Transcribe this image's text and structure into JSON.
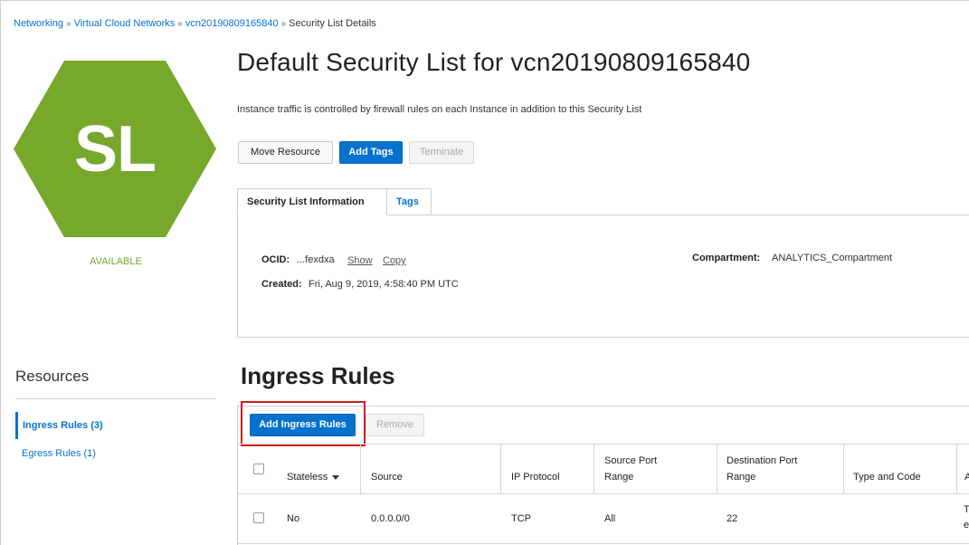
{
  "breadcrumb": {
    "items": [
      "Networking",
      "Virtual Cloud Networks",
      "vcn20190809165840"
    ],
    "current": "Security List Details",
    "separator": "»"
  },
  "resource_icon": {
    "text": "SL",
    "color": "#76a82c"
  },
  "status": "AVAILABLE",
  "page_title": "Default Security List for vcn20190809165840",
  "description": "Instance traffic is controlled by firewall rules on each Instance in addition to this Security List",
  "actions": {
    "move_resource": "Move Resource",
    "add_tags": "Add Tags",
    "terminate": "Terminate"
  },
  "tabs": [
    "Security List Information",
    "Tags"
  ],
  "info": {
    "ocid_label": "OCID:",
    "ocid_value": "...fexdxa",
    "show": "Show",
    "copy": "Copy",
    "created_label": "Created:",
    "created_value": "Fri, Aug 9, 2019, 4:58:40 PM UTC",
    "compartment_label": "Compartment:",
    "compartment_value": "ANALYTICS_Compartment"
  },
  "resources": {
    "title": "Resources",
    "items": [
      "Ingress Rules (3)",
      "Egress Rules (1)"
    ]
  },
  "ingress": {
    "title": "Ingress Rules",
    "add_button": "Add Ingress Rules",
    "remove_button": "Remove",
    "columns": [
      "Stateless",
      "Source",
      "IP Protocol",
      "Source Port\nRange",
      "Destination Port\nRange",
      "Type and Code",
      "A"
    ],
    "col_stateless": "Stateless",
    "col_source": "Source",
    "col_protocol": "IP Protocol",
    "col_src_port_1": "Source Port",
    "col_src_port_2": "Range",
    "col_dst_port_1": "Destination Port",
    "col_dst_port_2": "Range",
    "col_type_code": "Type and Code",
    "col_allows": "A",
    "rows": [
      {
        "stateless": "No",
        "source": "0.0.0.0/0",
        "protocol": "TCP",
        "source_port": "All",
        "destination_port": "22",
        "type_code": "",
        "allows_1": "T",
        "allows_2": "e"
      }
    ]
  },
  "colors": {
    "accent": "#0572ce",
    "brand_green": "#76a82c",
    "highlight": "#d11f1f"
  }
}
